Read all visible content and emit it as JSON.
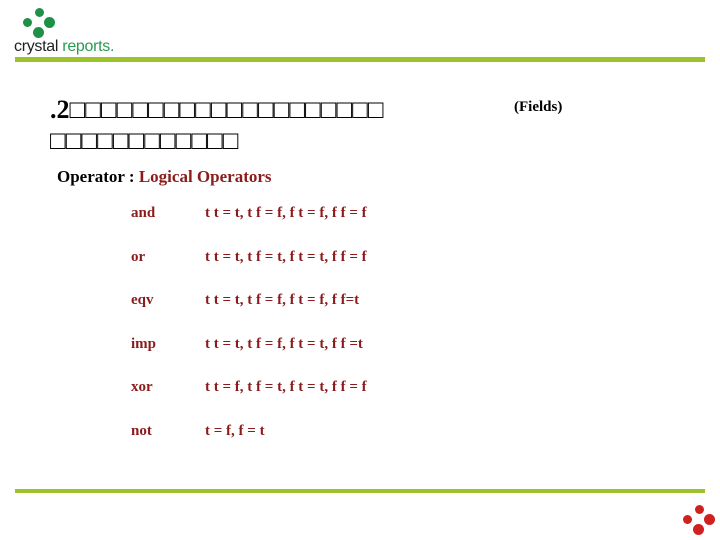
{
  "header": {
    "logo_icon": "crystal-diamond-dots-icon",
    "wordmark_first": "crystal",
    "wordmark_second": " reports.",
    "rule_color": "#9ec22a"
  },
  "title": {
    "line1_prefix": ".2",
    "line1_boxes": "⬛",
    "line1": ".2□□□□□□□□□□□□□□□□□□□□",
    "line1_overlay": "(Fields)",
    "line2": "□□□□□□□□□□□□"
  },
  "operator_heading": {
    "label": "Operator : ",
    "value": "Logical Operators",
    "label_color": "#000000",
    "value_color": "#8c1c1c"
  },
  "truth_table": {
    "rows": [
      {
        "operator": "and",
        "values": "t t = t, t f = f, f t = f, f f = f"
      },
      {
        "operator": "or",
        "values": "t t = t, t f = t, f t = t, f f = f"
      },
      {
        "operator": "eqv",
        "values": "t t = t, t f = f, f t = f, f f=t"
      },
      {
        "operator": "imp",
        "values": "t t = t, t f = f, f t = t, f f =t"
      },
      {
        "operator": "xor",
        "values": "t t = f, t f = t, f t = t, f f = f"
      },
      {
        "operator": "not",
        "values": "t = f, f = t"
      }
    ]
  },
  "footer": {
    "rule_color": "#9ec22a",
    "logo_icon": "crystal-diamond-dots-icon",
    "logo_color": "#d02020"
  }
}
